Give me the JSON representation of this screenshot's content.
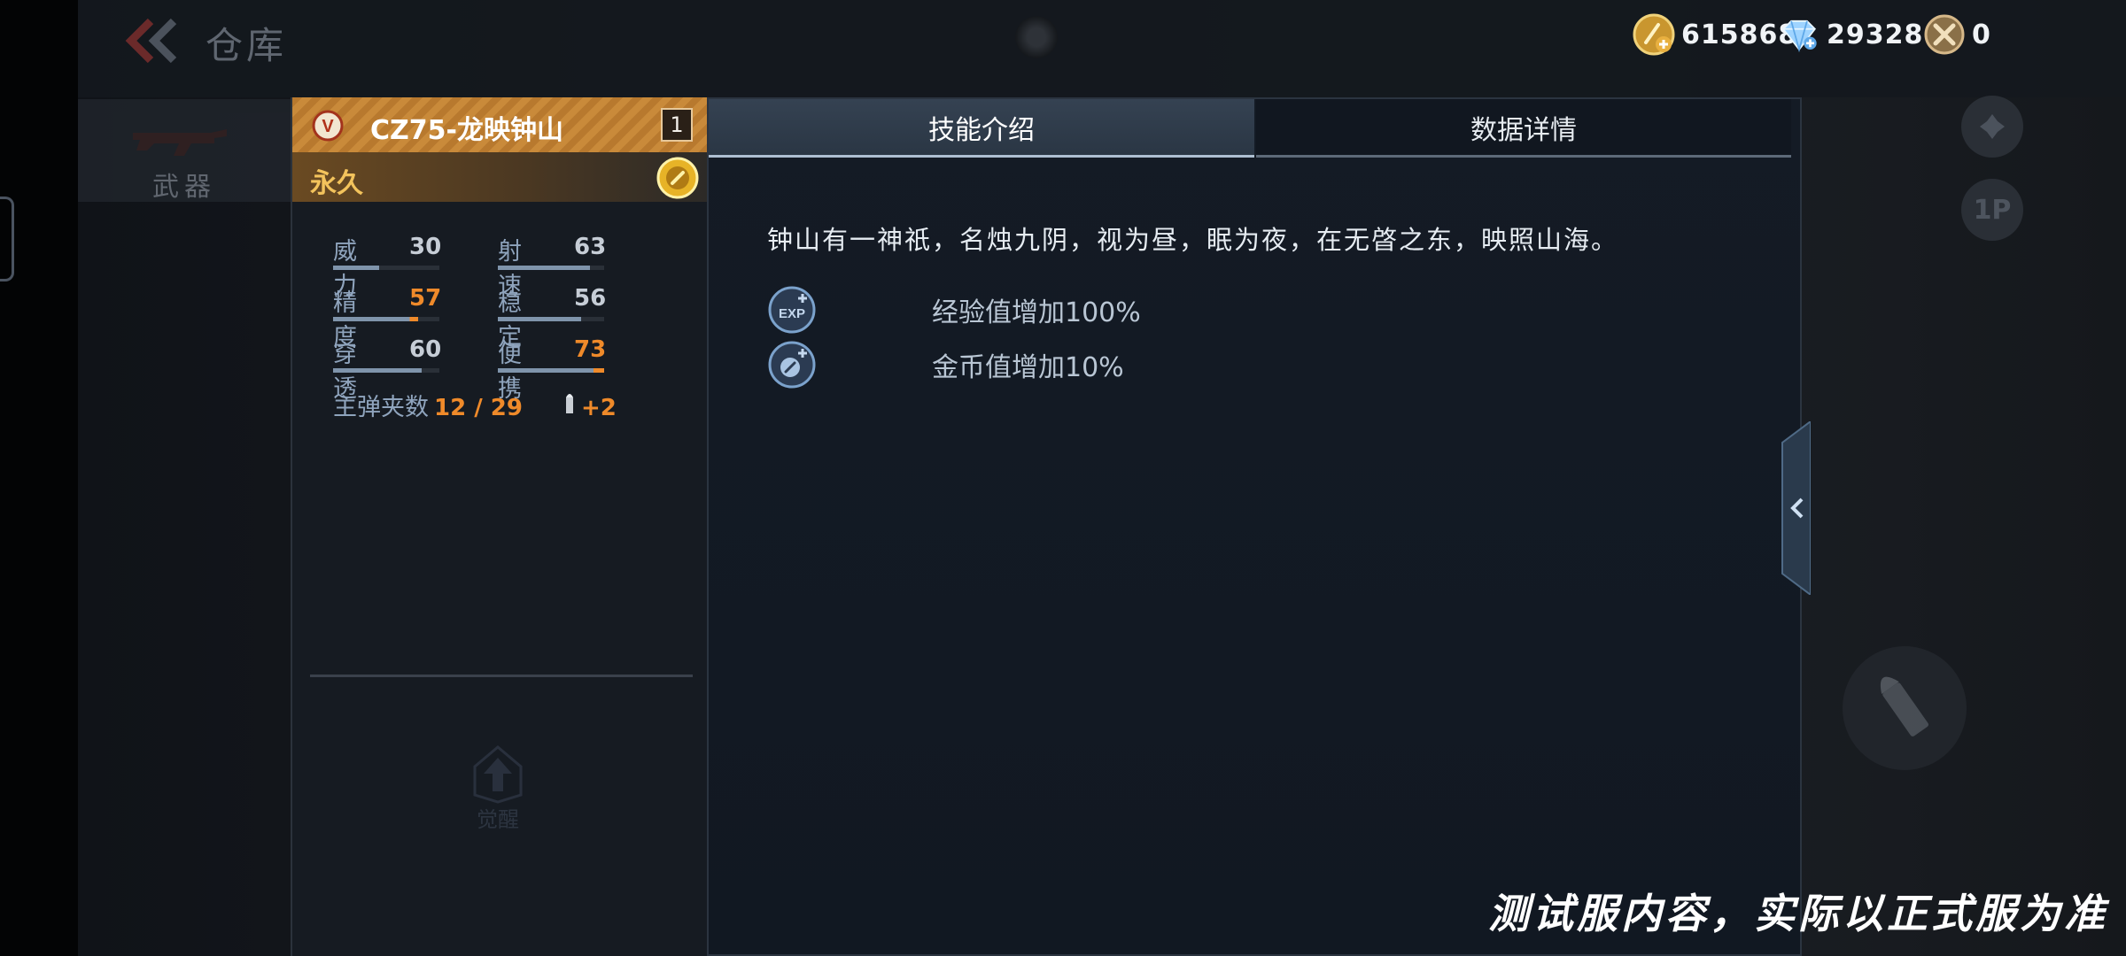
{
  "header": {
    "title": "仓库"
  },
  "currency": [
    {
      "name": "gold",
      "icon": "gold-coin-icon",
      "value": "615868"
    },
    {
      "name": "diamond",
      "icon": "diamond-icon",
      "value": "29328"
    },
    {
      "name": "token",
      "icon": "token-icon",
      "value": "0"
    }
  ],
  "nav": {
    "weapons_label": "武器"
  },
  "side_buttons": {
    "view_1p": "1P"
  },
  "card": {
    "weapon_name": "CZ75-龙映钟山",
    "vip_badge": "V",
    "level": "1",
    "duration": "永久",
    "stats": [
      {
        "label": "威力",
        "value": "30",
        "highlight": false
      },
      {
        "label": "射速",
        "value": "63",
        "highlight": false
      },
      {
        "label": "精度",
        "value": "57",
        "highlight": true
      },
      {
        "label": "稳定",
        "value": "56",
        "highlight": false
      },
      {
        "label": "穿透",
        "value": "60",
        "highlight": false
      },
      {
        "label": "便携",
        "value": "73",
        "highlight": true
      }
    ],
    "magazine_label": "主弹夹数",
    "magazine_value": "12 / 29",
    "ammo_bonus": "+2",
    "awaken_label": "觉醒"
  },
  "tabs": [
    {
      "label": "技能介绍",
      "active": true
    },
    {
      "label": "数据详情",
      "active": false
    }
  ],
  "skills": {
    "lore": "钟山有一神祇，名烛九阴，视为昼，眠为夜，在无晵之东，映照山海。",
    "items": [
      {
        "icon": "exp-boost-icon",
        "icon_text": "EXP",
        "text": "经验值增加100%"
      },
      {
        "icon": "coin-boost-icon",
        "text": "金币值增加10%"
      }
    ]
  },
  "watermark": "测试服内容，实际以正式服为准",
  "colors": {
    "accent_orange": "#ef8a2a",
    "gold_header": "#c98a3a",
    "duration_text": "#f3c35c",
    "stat_label": "#8fa4bd",
    "panel_bg": "#141b25"
  }
}
